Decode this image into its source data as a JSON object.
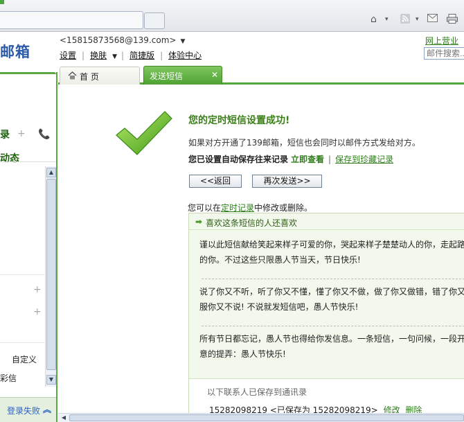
{
  "header": {
    "logo": "邮箱",
    "account": "<15815873568@139.com>",
    "links": [
      "设置",
      "换肤",
      "简捷版",
      "体验中心"
    ],
    "biz_hall": "网上营业厅",
    "search_placeholder": "邮件搜索..."
  },
  "tabs": {
    "home": "首 页",
    "sms": "发送短信"
  },
  "sidebar": {
    "section1": "录",
    "section2": "动态",
    "custom": "自定义",
    "mms": "彩信",
    "login_fail": "登录失败"
  },
  "main": {
    "title": "您的定时短信设置成功!",
    "desc": "如果对方开通了139邮箱，短信也会同时以邮件方式发给对方。",
    "auto_save": "您已设置自动保存往来记录",
    "view_now": "立即查看",
    "save_collection": "保存到珍藏记录",
    "back_button": "<<返回",
    "resend_button": "再次发送>>",
    "tip_prefix": "您可以在",
    "tip_link": "定时记录",
    "tip_suffix": "中修改或删除。"
  },
  "recommend": {
    "heading": "喜欢这条短信的人还喜欢",
    "messages": [
      {
        "line1": "谨以此短信献给笑起来样子可爱的你，哭起来样子楚楚动人的你，走起路",
        "line2": "的你。不过这些只限愚人节当天，节日快乐!"
      },
      {
        "line1": "说了你又不听，听了你又不懂，懂了你又不做，做了你又做错，错了你又",
        "line2": "服你又不说! 不说就发短信吧，愚人节快乐!"
      },
      {
        "line1": "所有节日都忘记，愚人节也得给你发信息。一条短信，一句问候，一段开",
        "line2": "意的提弄：愚人节快乐!"
      }
    ],
    "saved_notice": "以下联系人已保存到通讯录",
    "contact_number": "15282098219",
    "contact_saved_as": "<已保存为 15282098219>",
    "edit_label": "修改",
    "delete_label": "删除"
  },
  "colors": {
    "brand_green": "#52a83a",
    "title_green": "#3a7f17",
    "link_green": "#2e7d1a",
    "logo_blue": "#2a5aa8"
  }
}
